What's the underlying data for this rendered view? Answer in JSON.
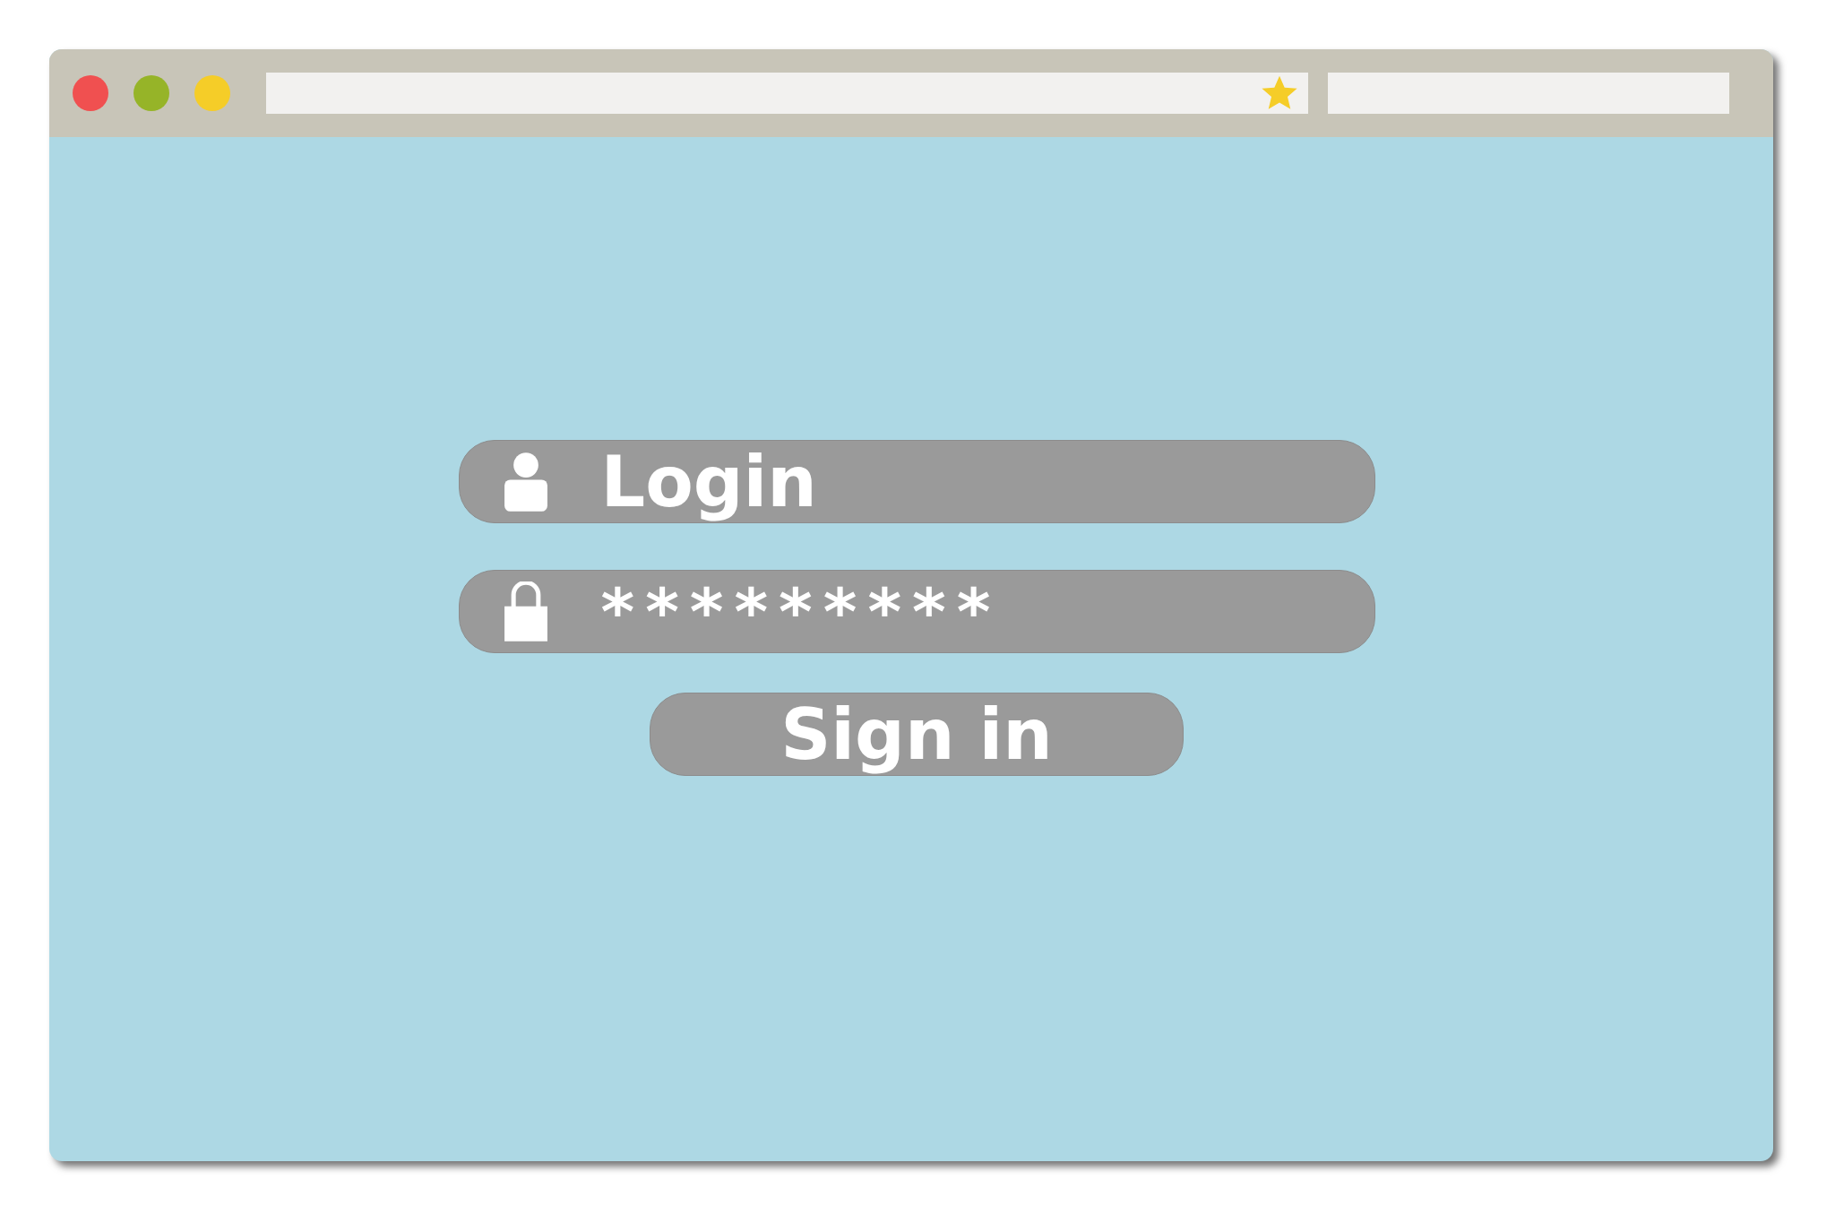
{
  "window_controls": [
    {
      "color": "#f05050"
    },
    {
      "color": "#96b428"
    },
    {
      "color": "#f5cd28"
    }
  ],
  "address_bar": {
    "bookmarked": true
  },
  "form": {
    "username": {
      "value": "Login"
    },
    "password": {
      "value": "*********"
    },
    "button": "Sign in"
  }
}
